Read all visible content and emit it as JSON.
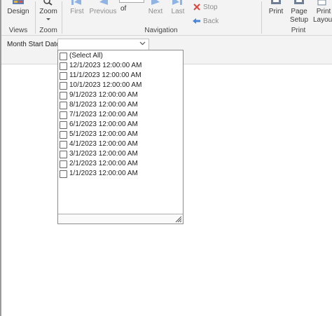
{
  "ribbon": {
    "design": "Design",
    "zoom": "Zoom",
    "first": "First",
    "previous": "Previous",
    "of": "of",
    "next": "Next",
    "last": "Last",
    "stop": "Stop",
    "back": "Back",
    "print": "Print",
    "page_setup_line1": "Page",
    "page_setup_line2": "Setup",
    "print_layout_line1": "Print",
    "print_layout_line2": "Layout",
    "groups": {
      "views": "Views",
      "zoom": "Zoom",
      "navigation": "Navigation",
      "print": "Print"
    }
  },
  "parameter": {
    "label": "Month Start Date",
    "selected_value": "",
    "options": [
      {
        "label": "(Select All)",
        "checked": false
      },
      {
        "label": "12/1/2023 12:00:00 AM",
        "checked": false
      },
      {
        "label": "11/1/2023 12:00:00 AM",
        "checked": false
      },
      {
        "label": "10/1/2023 12:00:00 AM",
        "checked": false
      },
      {
        "label": "9/1/2023 12:00:00 AM",
        "checked": false
      },
      {
        "label": "8/1/2023 12:00:00 AM",
        "checked": false
      },
      {
        "label": "7/1/2023 12:00:00 AM",
        "checked": false
      },
      {
        "label": "6/1/2023 12:00:00 AM",
        "checked": false
      },
      {
        "label": "5/1/2023 12:00:00 AM",
        "checked": false
      },
      {
        "label": "4/1/2023 12:00:00 AM",
        "checked": false
      },
      {
        "label": "3/1/2023 12:00:00 AM",
        "checked": false
      },
      {
        "label": "2/1/2023 12:00:00 AM",
        "checked": false
      },
      {
        "label": "1/1/2023 12:00:00 AM",
        "checked": false
      }
    ]
  },
  "colors": {
    "ribbon_bg": "#f3f3f3",
    "nav_blue": "#8fb4e3",
    "stop_red": "#e0463b",
    "back_blue": "#4a86d8"
  }
}
